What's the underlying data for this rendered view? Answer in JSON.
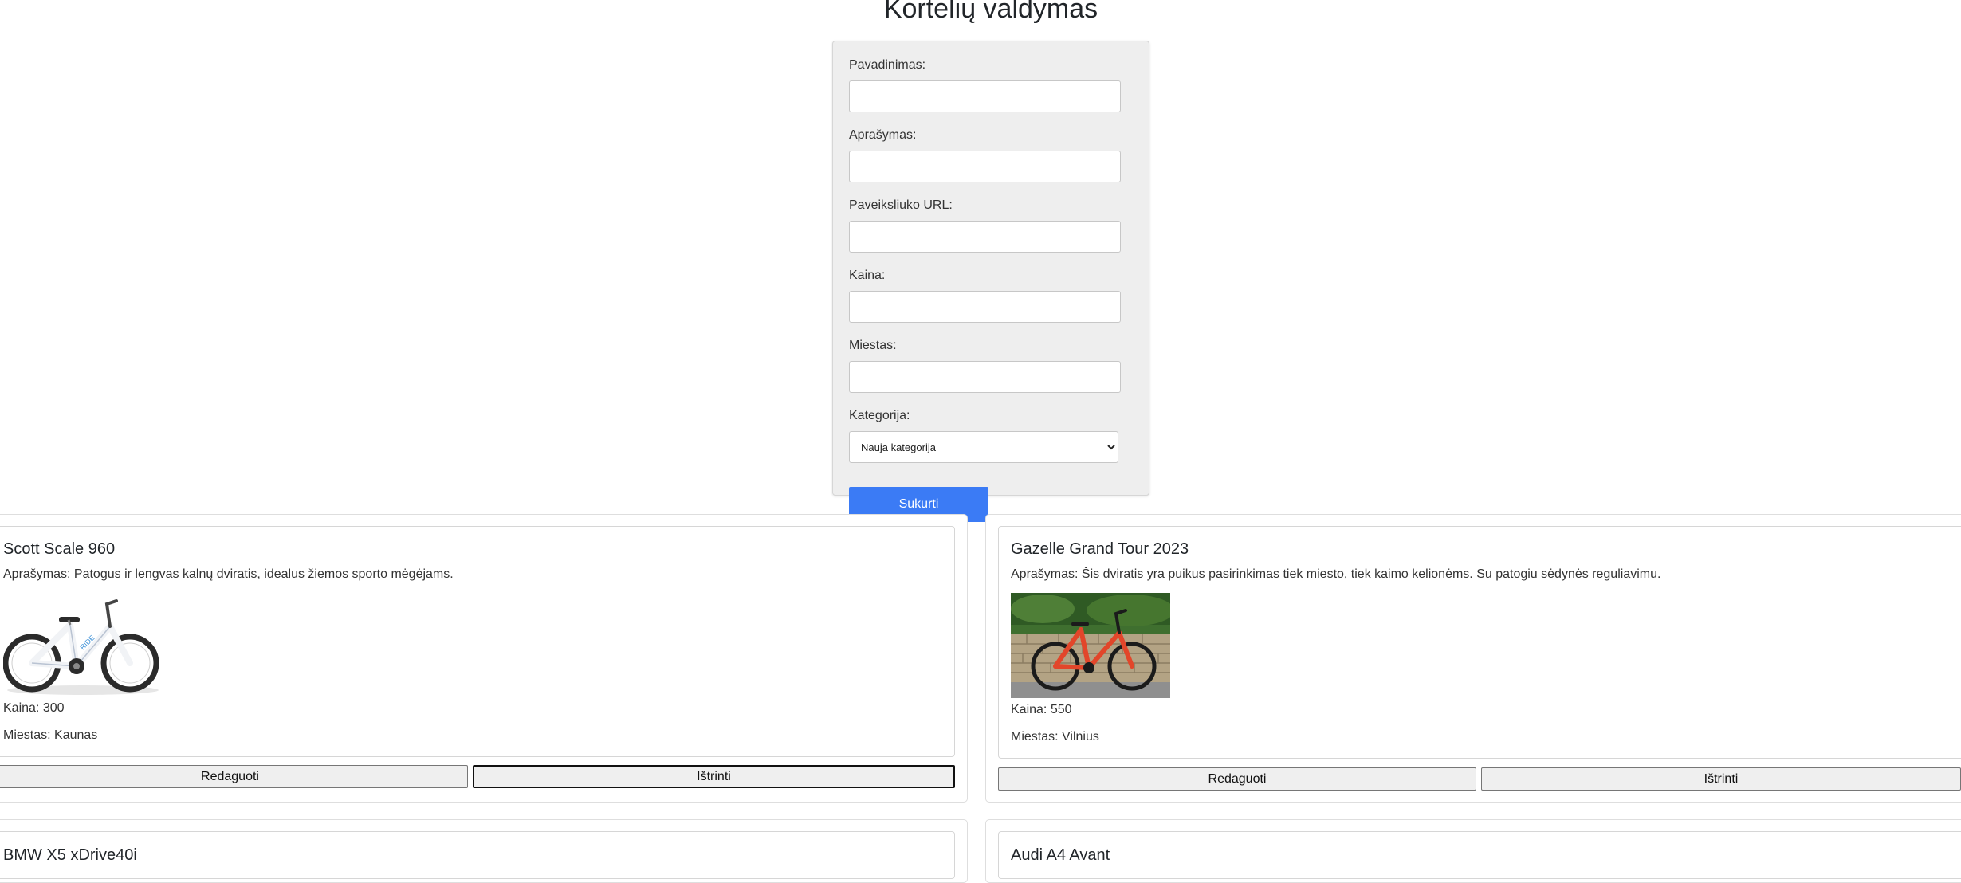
{
  "page": {
    "title": "Kortelių valdymas"
  },
  "form": {
    "name_label": "Pavadinimas:",
    "description_label": "Aprašymas:",
    "image_url_label": "Paveiksliuko URL:",
    "price_label": "Kaina:",
    "city_label": "Miestas:",
    "category_label": "Kategorija:",
    "category_selected": "Nauja kategorija",
    "submit_label": "Sukurti"
  },
  "cards": [
    {
      "title": "Scott Scale 960",
      "description": "Aprašymas: Patogus ir lengvas kalnų dviratis, idealus žiemos sporto mėgėjams.",
      "image_icon": "white-kids-bicycle-photo",
      "price": "Kaina: 300",
      "city": "Miestas: Kaunas",
      "edit_label": "Redaguoti",
      "delete_label": "Ištrinti"
    },
    {
      "title": "Gazelle Grand Tour 2023",
      "description": "Aprašymas: Šis dviratis yra puikus pasirinkimas tiek miesto, tiek kaimo kelionėms. Su patogiu sėdynės reguliavimu.",
      "image_icon": "red-bicycle-photo",
      "price": "Kaina: 550",
      "city": "Miestas: Vilnius",
      "edit_label": "Redaguoti",
      "delete_label": "Ištrinti"
    },
    {
      "title": "BMW X5 xDrive40i"
    },
    {
      "title": "Audi A4 Avant"
    }
  ],
  "colors": {
    "accent": "#3b7bf5",
    "panel": "#eeeeee"
  }
}
